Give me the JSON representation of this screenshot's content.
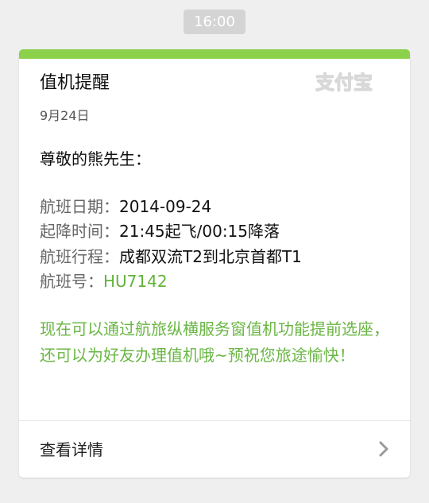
{
  "timestamp": "16:00",
  "card": {
    "title": "值机提醒",
    "brand": "支付宝",
    "date": "9月24日",
    "greeting": "尊敬的熊先生：",
    "details": [
      {
        "label": "航班日期：",
        "value": "2014-09-24"
      },
      {
        "label": "起降时间：",
        "value": "21:45起飞/00:15降落"
      },
      {
        "label": "航班行程：",
        "value": "成都双流T2到北京首都T1"
      },
      {
        "label": "航班号：",
        "value": "HU7142"
      }
    ],
    "notice": "现在可以通过航旅纵横服务窗值机功能提前选座，还可以为好友办理值机哦~预祝您旅途愉快！",
    "details_link": "查看详情"
  },
  "colors": {
    "accent": "#8cd14c",
    "link_green": "#62b33a",
    "notice_green": "#6ab644",
    "background": "#efefef"
  },
  "icons": {
    "brand": "alipay-logo",
    "link_arrow": "chevron-right-icon"
  }
}
